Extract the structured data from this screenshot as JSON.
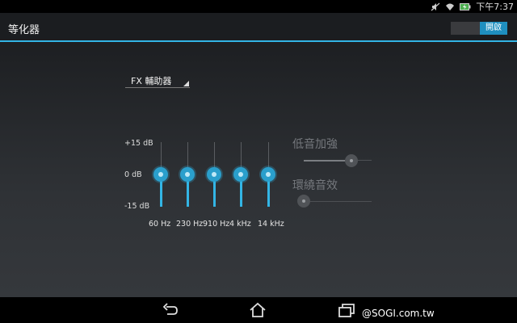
{
  "status_bar": {
    "time": "下午7:37",
    "icons": [
      "mute-icon",
      "wifi-icon",
      "battery-charging-icon"
    ]
  },
  "action_bar": {
    "title": "等化器",
    "toggle_label": "開啟",
    "toggle_on": true
  },
  "equalizer": {
    "preset_label": "FX 輔助器",
    "db_max_label": "+15 dB",
    "db_mid_label": "0 dB",
    "db_min_label": "-15 dB",
    "db_range": [
      -15,
      15
    ],
    "bands": [
      {
        "label": "60 Hz",
        "value_db": 0
      },
      {
        "label": "230 Hz",
        "value_db": 0
      },
      {
        "label": "910 Hz",
        "value_db": 0
      },
      {
        "label": "4 kHz",
        "value_db": 0
      },
      {
        "label": "14 kHz",
        "value_db": 0
      }
    ],
    "accent_color": "#33b5e5"
  },
  "effects": {
    "bass_boost": {
      "label": "低音加強",
      "level": 0.7,
      "enabled": false
    },
    "virtualizer": {
      "label": "環繞音效",
      "level": 0.0,
      "enabled": false
    }
  },
  "nav_bar": {
    "icons": [
      "back-icon",
      "home-icon",
      "recent-apps-icon"
    ]
  },
  "watermark": "@SOGI.com.tw"
}
